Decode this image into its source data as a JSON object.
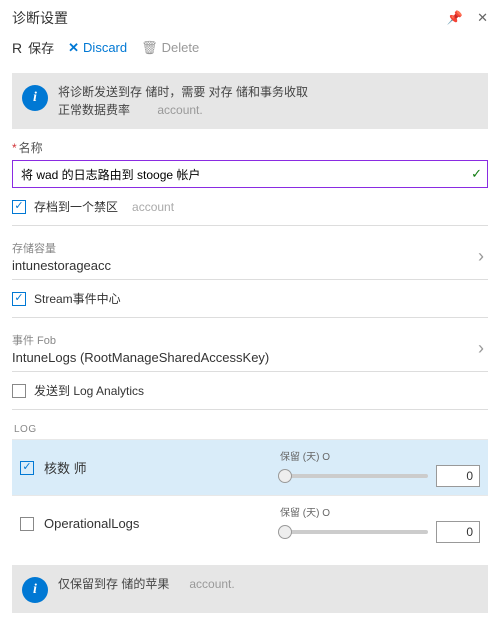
{
  "header": {
    "title": "诊断设置"
  },
  "toolbar": {
    "save_prefix": "R",
    "save_label": "保存",
    "discard_label": "Discard",
    "delete_label": "Delete"
  },
  "banner1": {
    "line1": "将诊断发送到存 储时，需要 对存 储和事务收取",
    "line2": "正常数据费率",
    "line2_sub": "account."
  },
  "name_field": {
    "label": "名称",
    "value": "将 wad 的日志路由到 stooge 帐户"
  },
  "options": {
    "archive": {
      "label": "存档到一个禁区",
      "sub": "account",
      "checked": true
    },
    "storage": {
      "label": "存储容量",
      "value": "intunestorageacc"
    },
    "eventhub_check": {
      "label": "Stream事件中心",
      "checked": true
    },
    "eventhub_sel": {
      "label": "事件 Fob",
      "value": "IntuneLogs (RootManageSharedAccessKey)"
    },
    "loganalytics": {
      "label": "发送到 Log Analytics",
      "checked": false
    }
  },
  "log_section": {
    "title": "LOG",
    "retention_label": "保留 (天) O",
    "rows": [
      {
        "name": "核数 师",
        "checked": true,
        "value": "0"
      },
      {
        "name": "OperationalLogs",
        "checked": false,
        "value": "0"
      }
    ]
  },
  "banner2": {
    "text": "仅保留到存 储的苹果",
    "sub": "account."
  }
}
